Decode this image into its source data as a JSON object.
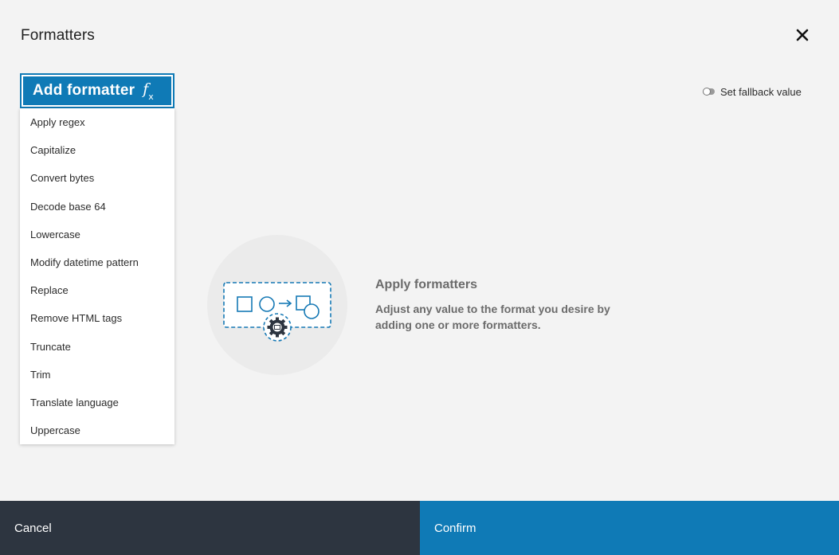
{
  "dialog": {
    "title": "Formatters",
    "close_icon": "close-icon"
  },
  "add_formatter": {
    "label": "Add formatter",
    "icon": "fx-icon",
    "icon_main": "f",
    "icon_sub": "x"
  },
  "menu": {
    "items": [
      {
        "label": "Apply regex"
      },
      {
        "label": "Capitalize"
      },
      {
        "label": "Convert bytes"
      },
      {
        "label": "Decode base 64"
      },
      {
        "label": "Lowercase"
      },
      {
        "label": "Modify datetime pattern"
      },
      {
        "label": "Replace"
      },
      {
        "label": "Remove HTML tags"
      },
      {
        "label": "Truncate"
      },
      {
        "label": "Trim"
      },
      {
        "label": "Translate language"
      },
      {
        "label": "Uppercase"
      }
    ]
  },
  "fallback": {
    "label": "Set fallback value",
    "enabled": false
  },
  "empty_state": {
    "icon": "formatter-illustration-icon",
    "title": "Apply formatters",
    "description": "Adjust any value to the format you desire by adding one or more formatters."
  },
  "footer": {
    "cancel_label": "Cancel",
    "confirm_label": "Confirm"
  },
  "colors": {
    "accent": "#0f7ab6",
    "footer_dark": "#2d3540",
    "background": "#f3f3f3"
  }
}
